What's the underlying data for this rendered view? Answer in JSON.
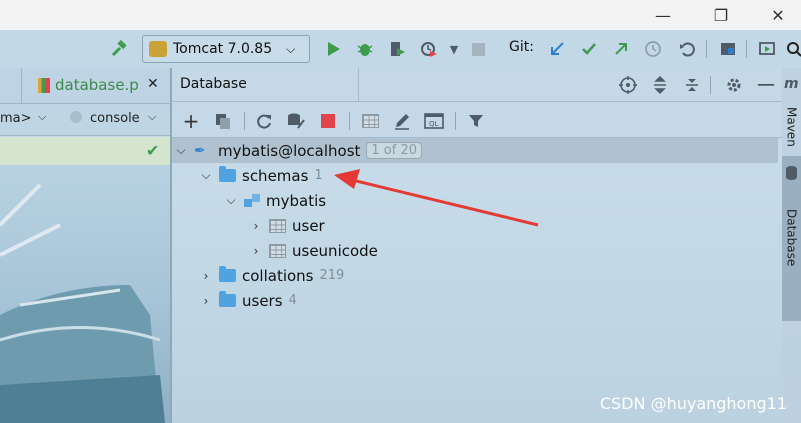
{
  "window": {
    "minimize": "—",
    "maximize": "❐",
    "close": "✕"
  },
  "toolbar": {
    "run_config_label": "Tomcat 7.0.85",
    "git_label": "Git:"
  },
  "left_panel": {
    "file_tab": "database.p",
    "schema_selector": "ma>",
    "console_selector": "console"
  },
  "database_panel": {
    "title": "Database",
    "tree": [
      {
        "label": "mybatis@localhost",
        "badge": "1 of 20"
      },
      {
        "label": "schemas",
        "count": "1"
      },
      {
        "label": "mybatis"
      },
      {
        "label": "user"
      },
      {
        "label": "useunicode"
      },
      {
        "label": "collations",
        "count": "219"
      },
      {
        "label": "users",
        "count": "4"
      }
    ]
  },
  "right_strip": {
    "maven_label": "Maven",
    "database_label": "Database"
  },
  "watermark": "CSDN @huyanghong11",
  "colors": {
    "accent_green": "#3e9c4e",
    "folder_blue": "#4fa3e0",
    "arrow_red": "#e53935",
    "stop_red": "#e0454c"
  }
}
